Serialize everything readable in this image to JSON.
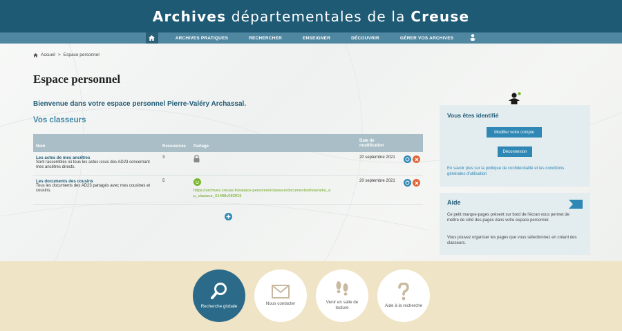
{
  "header": {
    "title_bold_1": "Archives",
    "title_light": "départementales de la",
    "title_bold_2": "Creuse"
  },
  "nav": {
    "items": [
      "ARCHIVES PRATIQUES",
      "RECHERCHER",
      "ENSEIGNER",
      "DÉCOUVRIR",
      "GÉRER VOS ARCHIVES"
    ]
  },
  "breadcrumb": {
    "home": "Accueil",
    "separator": ">",
    "current": "Espace personnel"
  },
  "page": {
    "title": "Espace personnel",
    "welcome": "Bienvenue dans votre espace personnel Pierre-Valéry Archassal.",
    "section": "Vos classeurs"
  },
  "table": {
    "headers": {
      "name": "Nom",
      "resources": "Ressources",
      "share": "Partage",
      "date": "Date de modification"
    },
    "rows": [
      {
        "name": "Les actes de mes ancêtres",
        "desc": "Sont rassemblés ici tous les actes issus des AD23 concernant mes ancêtres directs.",
        "resources": "3",
        "share": "",
        "date": "20 septembre 2021"
      },
      {
        "name": "Les documents des cousins",
        "desc": "Tous les documents des AD23 partagés avec mes cousines et cousins.",
        "resources": "5",
        "share": "https://archives.creuse.fr/espace-personnel/classeur/documents/show/arko_ep_classeur_61488c082ff19",
        "date": "20 septembre 2021"
      }
    ]
  },
  "identity": {
    "title": "Vous êtes identifié",
    "modify": "Modifier votre compte",
    "logout": "Déconnexion",
    "privacy": "En savoir plus sur la politique de confidentialité et les conditions générales d'utilisation"
  },
  "help": {
    "title": "Aide",
    "p1": "Ce petit marque-pages présent sur bord de l'écran vous permet de mettre de côté des pages dans votre espace personnel.",
    "p2": "Vous pouvez organiser les pages que vous sélectionnez en créant des classeurs."
  },
  "footer": {
    "search": "Recherche globale",
    "contact": "Nous contacter",
    "visit": "Venir en salle de lecture",
    "help": "Aide à la recherche"
  },
  "colors": {
    "header": "#1f5a75",
    "nav": "#4f86a0",
    "accent": "#2e87b4",
    "footer_bg": "#efe4c6",
    "share_green": "#76b82a",
    "delete_orange": "#e0663a"
  },
  "icons": {
    "home": "home-icon",
    "user": "user-icon",
    "lock": "lock-icon",
    "smile": "smile-icon",
    "edit": "edit-icon",
    "delete": "delete-icon",
    "add": "add-icon",
    "search": "search-icon",
    "mail": "mail-icon",
    "footsteps": "footsteps-icon",
    "question": "question-icon"
  }
}
